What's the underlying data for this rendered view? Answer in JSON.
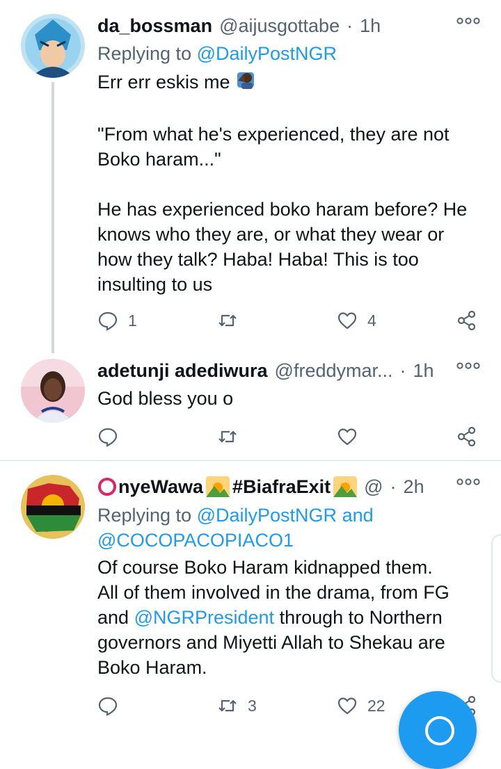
{
  "tweets": [
    {
      "name": "da_bossman",
      "handle": "@aijusgottabe",
      "time": "1h",
      "more_icon": "more-dots-icon",
      "reply_prefix": "Replying to",
      "reply_to": "@DailyPostNGR",
      "body_lines": [
        "Err err eskis me",
        "",
        "\"From what he's experienced, they are not",
        "Boko haram...\"",
        "",
        "He has experienced boko haram before? He",
        "knows who they are, or what they wear or",
        "how they talk? Haba! Haba! This is too",
        "insulting to us"
      ],
      "reply_count": "1",
      "retweet_count": "",
      "like_count": "4"
    },
    {
      "name": "adetunji adediwura",
      "handle": "@freddymar...",
      "time": "1h",
      "body": "God bless you o",
      "reply_count": "",
      "retweet_count": "",
      "like_count": ""
    },
    {
      "name_text_1": "nyeWawa",
      "name_hashtag": "#BiafraExit",
      "handle": "@",
      "time": "2h",
      "reply_prefix": "Replying to",
      "reply_to_1": "@DailyPostNGR",
      "reply_and": "and",
      "reply_to_2": "@COCOPACOPIACO1",
      "body_line_1": "Of course Boko Haram kidnapped them.",
      "body_line_2": "All of them involved in the drama, from FG",
      "body_line_3_pre": "and",
      "body_line_3_link": "@NGRPresident",
      "body_line_3_post": "through to Northern",
      "body_line_4": "governors and Miyetti Allah to Shekau are",
      "body_line_5": "Boko Haram.",
      "reply_count": "",
      "retweet_count": "3",
      "like_count": "22"
    }
  ],
  "colors": {
    "link": "#1d9bf0",
    "secondary": "#536471",
    "fab": "#1d9bf0",
    "divider": "#cfd9de"
  },
  "icons": [
    "reply-icon",
    "retweet-icon",
    "like-icon",
    "share-icon",
    "more-dots-icon",
    "compose-icon"
  ]
}
